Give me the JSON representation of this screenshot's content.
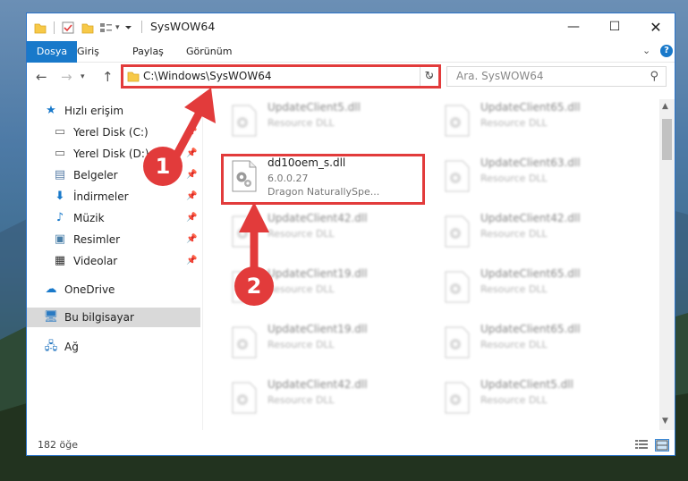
{
  "window": {
    "title": "SysWOW64"
  },
  "ribbon": {
    "tabs": [
      "Dosya",
      "Giriş",
      "Paylaş",
      "Görünüm"
    ]
  },
  "address": {
    "path": "C:\\Windows\\SysWOW64",
    "search_placeholder": "Ara. SysWOW64"
  },
  "sidebar": {
    "items": [
      {
        "label": "Hızlı erişim",
        "icon": "star-icon"
      },
      {
        "label": "Yerel Disk (C:)",
        "icon": "drive-icon"
      },
      {
        "label": "Yerel Disk (D:)",
        "icon": "drive-icon"
      },
      {
        "label": "Belgeler",
        "icon": "documents-icon"
      },
      {
        "label": "İndirmeler",
        "icon": "download-icon"
      },
      {
        "label": "Müzik",
        "icon": "music-icon"
      },
      {
        "label": "Resimler",
        "icon": "pictures-icon"
      },
      {
        "label": "Videolar",
        "icon": "video-icon"
      },
      {
        "label": "OneDrive",
        "icon": "cloud-icon"
      },
      {
        "label": "Bu bilgisayar",
        "icon": "computer-icon"
      },
      {
        "label": "Ağ",
        "icon": "network-icon"
      }
    ]
  },
  "files": [
    {
      "name": "UpdateClient5.dll",
      "line2": "Resource DLL",
      "line3": ""
    },
    {
      "name": "UpdateClient65.dll",
      "line2": "Resource DLL",
      "line3": ""
    },
    {
      "name": "dd10oem_s.dll",
      "line2": "6.0.0.27",
      "line3": "Dragon NaturallySpe..."
    },
    {
      "name": "UpdateClient63.dll",
      "line2": "Resource DLL",
      "line3": ""
    },
    {
      "name": "UpdateClient42.dll",
      "line2": "Resource DLL",
      "line3": ""
    },
    {
      "name": "UpdateClient42.dll",
      "line2": "Resource DLL",
      "line3": ""
    },
    {
      "name": "UpdateClient19.dll",
      "line2": "Resource DLL",
      "line3": ""
    },
    {
      "name": "UpdateClient65.dll",
      "line2": "Resource DLL",
      "line3": ""
    },
    {
      "name": "UpdateClient19.dll",
      "line2": "Resource DLL",
      "line3": ""
    },
    {
      "name": "UpdateClient65.dll",
      "line2": "Resource DLL",
      "line3": ""
    },
    {
      "name": "UpdateClient42.dll",
      "line2": "Resource DLL",
      "line3": ""
    },
    {
      "name": "UpdateClient5.dll",
      "line2": "Resource DLL",
      "line3": ""
    }
  ],
  "status": {
    "count": "182 öğe"
  },
  "callouts": {
    "one": "1",
    "two": "2"
  },
  "colors": {
    "accent": "#1979ca",
    "highlight": "#e23b3b"
  }
}
